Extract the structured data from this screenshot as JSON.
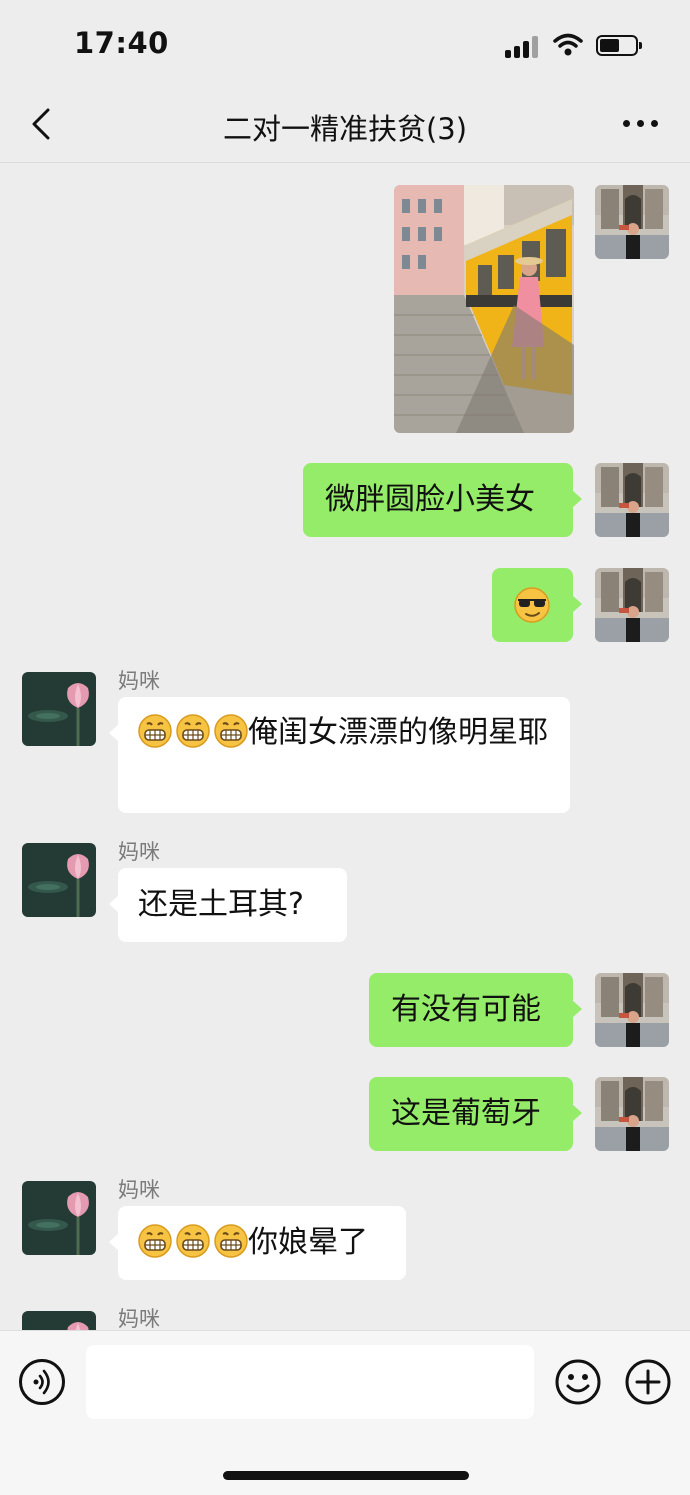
{
  "status_bar": {
    "time": "17:40",
    "signal_icon": "cellular-signal-icon",
    "wifi_icon": "wifi-icon",
    "battery_icon": "battery-icon"
  },
  "nav": {
    "title": "二对一精准扶贫(3)",
    "back_icon": "chevron-left-icon",
    "more_icon": "more-dots-icon"
  },
  "messages": [
    {
      "side": "me",
      "type": "image",
      "content_desc": "photo"
    },
    {
      "side": "me",
      "type": "text",
      "text": "微胖圆脸小美女"
    },
    {
      "side": "me",
      "type": "emoji",
      "emoji": "😎"
    },
    {
      "side": "them",
      "sender": "妈咪",
      "type": "text",
      "emojis": "😁😁😁",
      "text": "俺闺女漂漂的像明星耶"
    },
    {
      "side": "them",
      "sender": "妈咪",
      "type": "text",
      "text": "还是土耳其?"
    },
    {
      "side": "me",
      "type": "text",
      "text": "有没有可能"
    },
    {
      "side": "me",
      "type": "text",
      "text": "这是葡萄牙"
    },
    {
      "side": "them",
      "sender": "妈咪",
      "type": "text",
      "emojis": "😁😁😁",
      "text": "你娘晕了"
    },
    {
      "side": "them",
      "sender": "妈咪",
      "type": "partial"
    }
  ],
  "input_bar": {
    "voice_icon": "voice-icon",
    "emoji_icon": "emoji-icon",
    "plus_icon": "plus-icon",
    "input_value": ""
  },
  "colors": {
    "background": "#ededed",
    "my_bubble": "#95ec69",
    "their_bubble": "#ffffff",
    "sender_name": "#7b7b7b"
  }
}
